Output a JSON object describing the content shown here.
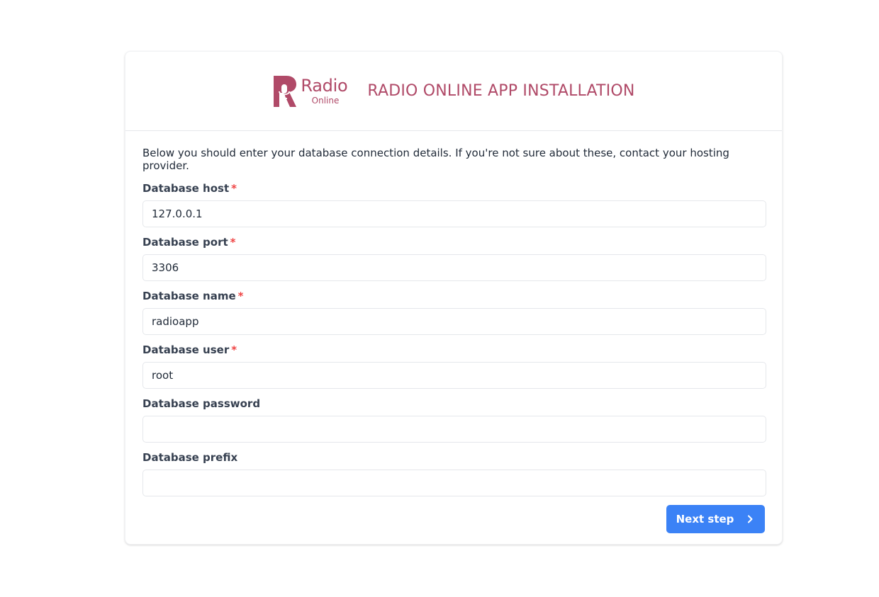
{
  "header": {
    "logo_word": "Radio",
    "logo_sub": "Online",
    "title": "RADIO ONLINE APP INSTALLATION"
  },
  "form": {
    "intro": "Below you should enter your database connection details. If you're not sure about these, contact your hosting provider.",
    "required_marker": "*",
    "fields": [
      {
        "label": "Database host",
        "value": "127.0.0.1",
        "required": true
      },
      {
        "label": "Database port",
        "value": "3306",
        "required": true
      },
      {
        "label": "Database name",
        "value": "radioapp",
        "required": true
      },
      {
        "label": "Database user",
        "value": "root",
        "required": true
      },
      {
        "label": "Database password",
        "value": "",
        "required": false
      },
      {
        "label": "Database prefix",
        "value": "",
        "required": false
      }
    ],
    "next_label": "Next step"
  },
  "icons": {
    "logo": "radio-microphone-logo-icon",
    "next": "chevron-right-icon"
  },
  "colors": {
    "brand": "#b04a68",
    "accent": "#3b82f6",
    "required": "#ef4444"
  }
}
